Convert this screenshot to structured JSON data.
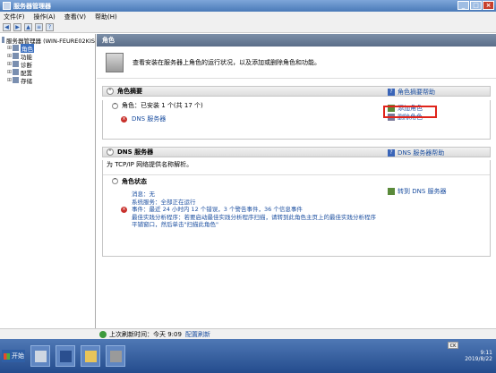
{
  "window": {
    "title": "服务器管理器"
  },
  "menu": [
    "文件(F)",
    "操作(A)",
    "查看(V)",
    "帮助(H)"
  ],
  "tree": {
    "root": "服务器管理器 (WIN-FEURE02KIS",
    "items": [
      "角色",
      "功能",
      "诊断",
      "配置",
      "存储"
    ]
  },
  "pane": {
    "header": "角色",
    "intro": "查看安装在服务器上角色的运行状况，以及添加或删除角色和功能。",
    "summary": {
      "title": "角色摘要",
      "help": "角色摘要帮助",
      "roles_label": "角色：已安装 1 个(共 17 个)",
      "role_item": "DNS 服务器",
      "add_role": "添加角色",
      "remove_role": "删除角色"
    },
    "dns": {
      "title": "DNS 服务器",
      "help": "DNS 服务器帮助",
      "description": "为 TCP/IP 网络提供名称解析。",
      "status_title": "角色状态",
      "goto": "转到 DNS 服务器",
      "messages": "消息：无",
      "system_services": "系统服务：全部正在运行",
      "events": "事件：最近 24 小时内 12 个错误，3 个警告事件，36 个信息事件",
      "bpa_line1": "最佳实践分析程序：若要启动最佳实践分析程序扫描，请转到此角色主页上的最佳实践分析程序",
      "bpa_line2": "平铺窗口，然后单击\"扫描此角色\""
    }
  },
  "status": {
    "last_refresh": "上次刷新时间：今天 9:09",
    "configure_refresh": "配置刷新"
  },
  "taskbar": {
    "start": "开始",
    "ck": "CK",
    "time": "9:11",
    "date": "2019/8/22"
  }
}
